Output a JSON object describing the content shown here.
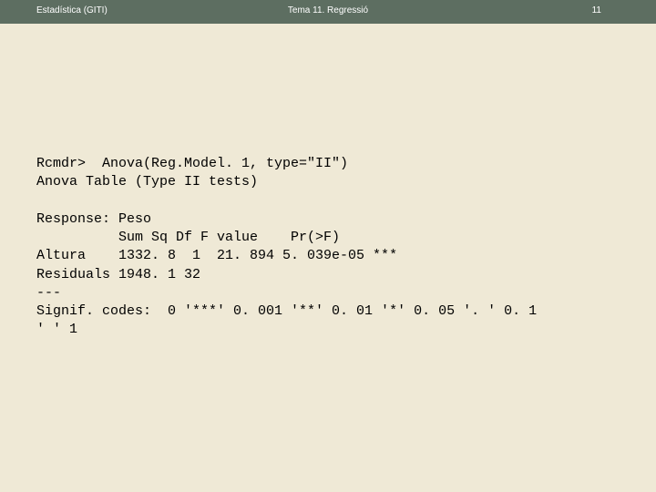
{
  "header": {
    "left": "Estadística (GITI)",
    "center": "Tema 11. Regressió",
    "page": "11"
  },
  "code": {
    "line1": "Rcmdr>  Anova(Reg.Model. 1, type=\"II\")",
    "line2": "Anova Table (Type II tests)",
    "line3": "",
    "line4": "Response: Peso",
    "line5": "          Sum Sq Df F value    Pr(>F)",
    "line6": "Altura    1332. 8  1  21. 894 5. 039e-05 ***",
    "line7": "Residuals 1948. 1 32",
    "line8": "---",
    "line9": "Signif. codes:  0 '***' 0. 001 '**' 0. 01 '*' 0. 05 '. ' 0. 1",
    "line10": "' ' 1"
  }
}
